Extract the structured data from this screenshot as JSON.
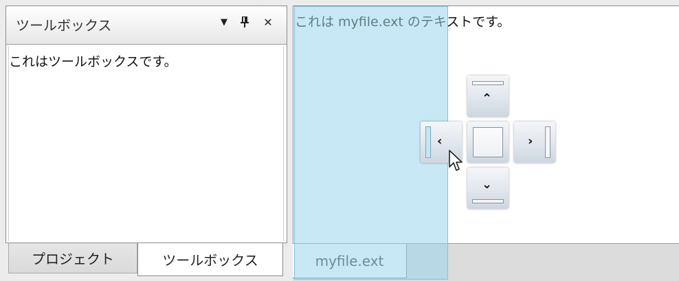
{
  "toolbox": {
    "title": "ツールボックス",
    "content": "これはツールボックスです。",
    "icons": [
      "dropdown-icon",
      "pin-icon",
      "close-icon"
    ]
  },
  "tool_tabs": [
    "プロジェクト",
    "ツールボックス"
  ],
  "document": {
    "text": "これは myfile.ext のテキストです。",
    "tab_label": "myfile.ext"
  },
  "dock_guide": {
    "buttons": [
      "dock-top-icon",
      "dock-bottom-icon",
      "dock-left-icon",
      "dock-right-icon",
      "dock-fill-icon"
    ]
  },
  "colors": {
    "dock_preview": "#99d6eb",
    "tab_strip": "#dcdcdc"
  }
}
